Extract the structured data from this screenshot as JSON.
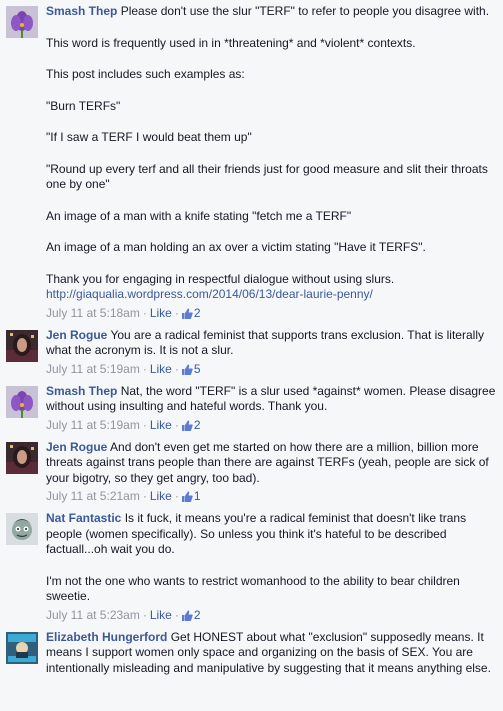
{
  "comments": [
    {
      "author": "Smash Thep",
      "avatar": "purple-crocus-flower",
      "first_line": "Please don't use the slur \"TERF\" to refer to people you disagree with.",
      "paragraphs": [
        "This word is frequently used in in *threatening* and *violent* contexts.",
        "This post includes such examples as:",
        "\"Burn TERFs\"",
        "\"If I saw a TERF I would beat them up\"",
        "\"Round up every terf and all their friends just for good measure and slit their throats one by one\"",
        "An image of a man with a knife stating \"fetch me a TERF\"",
        "An image of a man holding an ax over a victim stating \"Have it TERFS\"."
      ],
      "closing": "Thank you for engaging in respectful dialogue without using slurs.",
      "link": "http://giaqualia.wordpress.com/2014/06/13/dear-laurie-penny/",
      "time": "July 11 at 5:18am",
      "like_label": "Like",
      "likes": "2"
    },
    {
      "author": "Jen Rogue",
      "avatar": "woman-portrait",
      "first_line": "You are a radical feminist that supports trans exclusion. That is literally what the acronym is. It is not a slur.",
      "time": "July 11 at 5:19am",
      "like_label": "Like",
      "likes": "5"
    },
    {
      "author": "Smash Thep",
      "avatar": "purple-crocus-flower",
      "first_line": "Nat, the word \"TERF\" is a slur used *against* women. Please disagree without using insulting and hateful words. Thank you.",
      "time": "July 11 at 5:19am",
      "like_label": "Like",
      "likes": "2"
    },
    {
      "author": "Jen Rogue",
      "avatar": "woman-portrait",
      "first_line": "And don't even get me started on how there are a million, billion more threats against trans people than there are against TERFs (yeah, people are sick of your bigotry, so they get angry, too bad).",
      "time": "July 11 at 5:21am",
      "like_label": "Like",
      "likes": "1"
    },
    {
      "author": "Nat Fantastic",
      "avatar": "cartoon-face",
      "first_line": "Is it fuck, it means you're a radical feminist that doesn't like trans people (women specifically). So unless you think it's hateful to be described factuall...oh wait you do.",
      "paragraphs": [
        "I'm not the one who wants to restrict womanhood to the ability to bear children sweetie."
      ],
      "time": "July 11 at 5:23am",
      "like_label": "Like",
      "likes": "2"
    },
    {
      "author": "Elizabeth Hungerford",
      "avatar": "badge-image",
      "first_line": "Get HONEST about what \"exclusion\" supposedly means. It means I support women only space and organizing on the basis of SEX. You are intentionally misleading and manipulative by suggesting that it means anything else."
    }
  ],
  "meta_separator": "·"
}
